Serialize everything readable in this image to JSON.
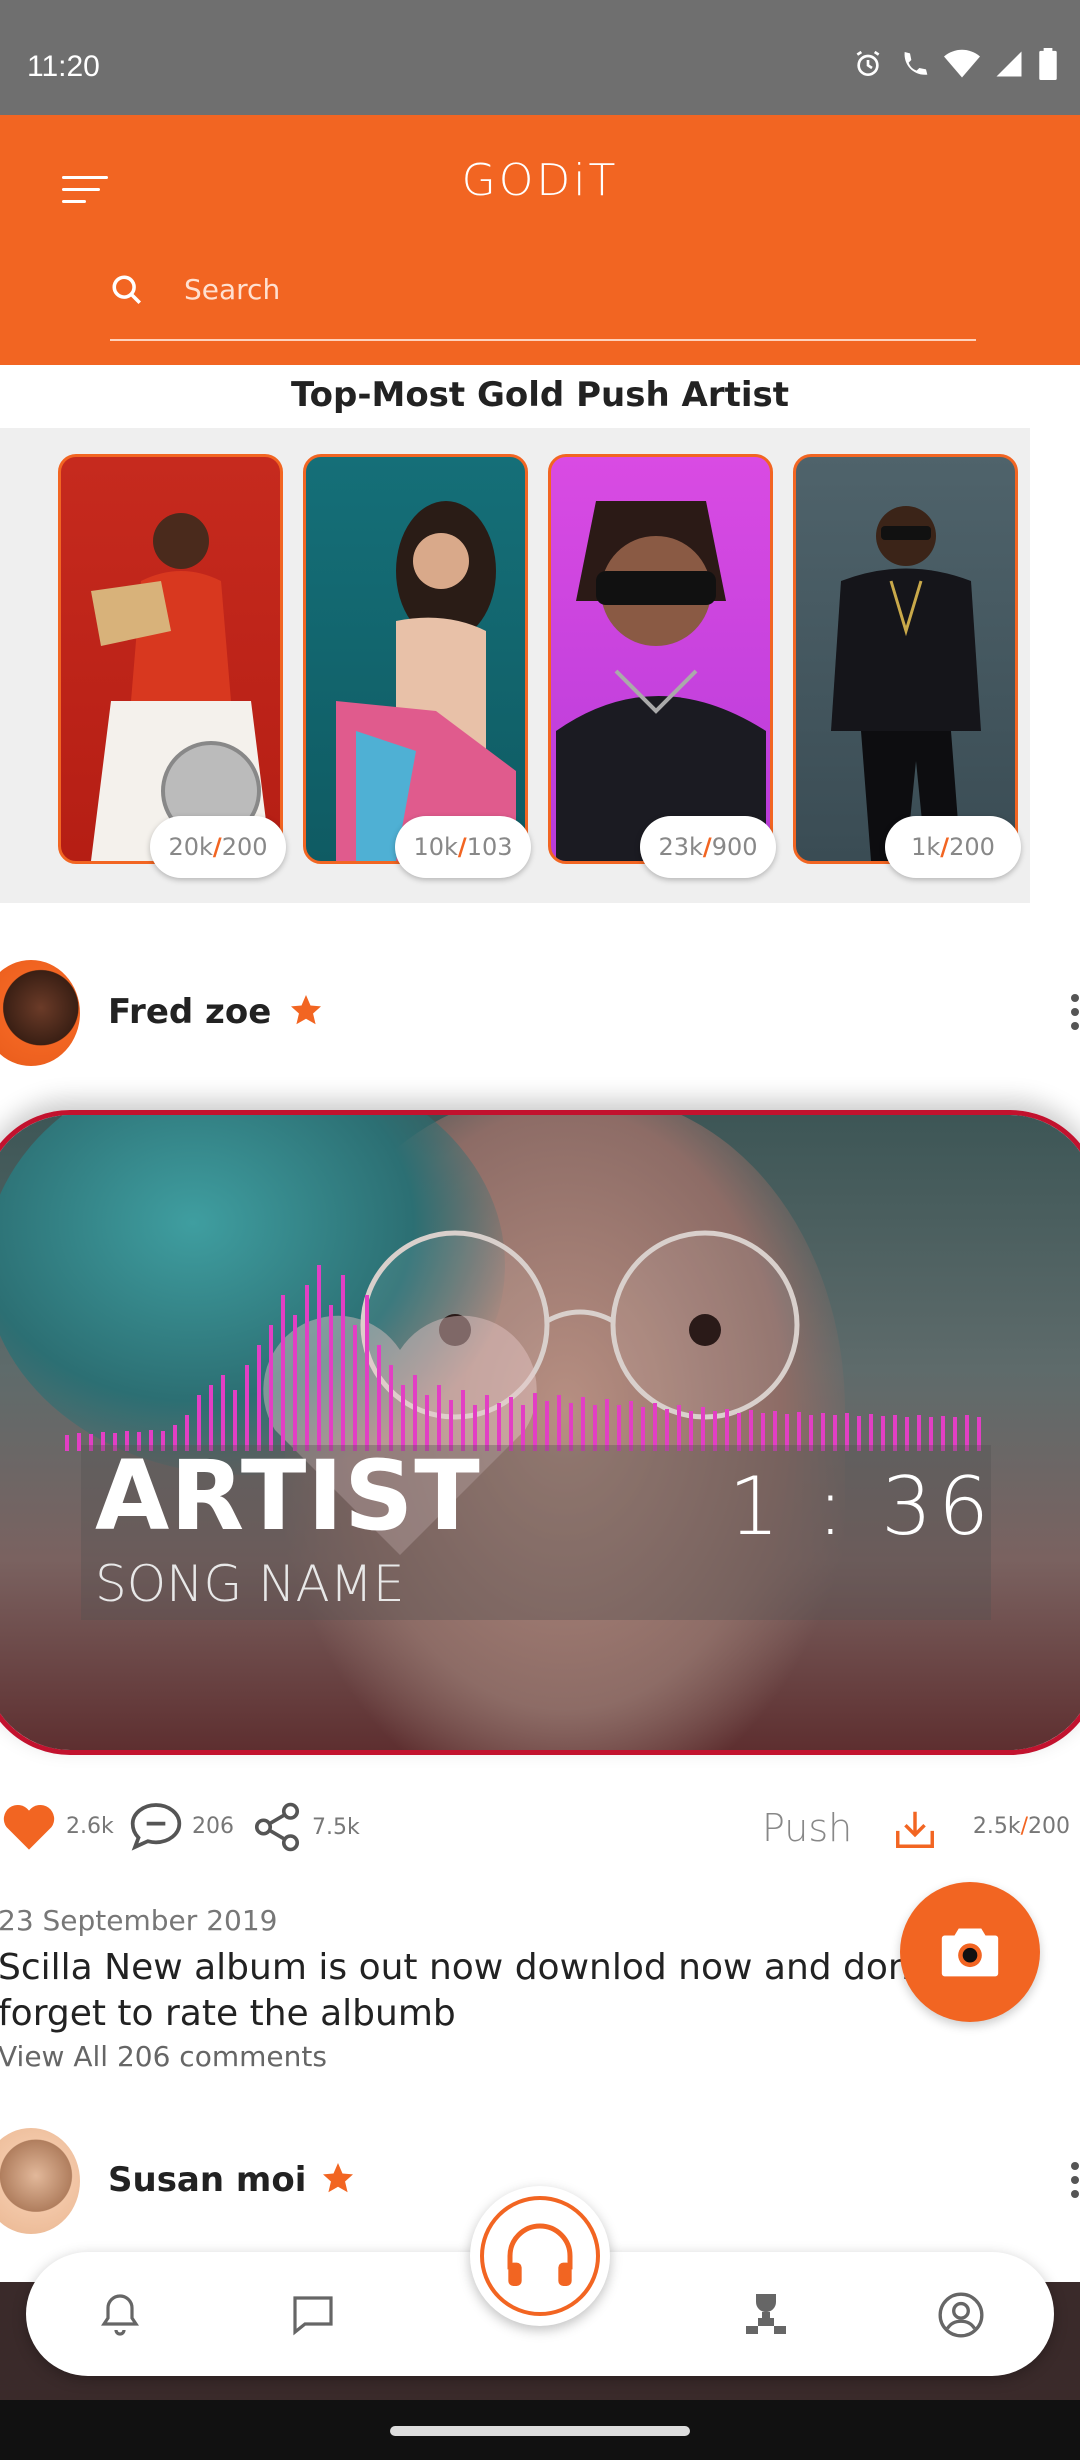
{
  "status_bar": {
    "time": "11:20",
    "icons": [
      "alarm-icon",
      "wifi-call-icon",
      "wifi-icon",
      "signal-icon",
      "battery-icon"
    ]
  },
  "header": {
    "title": "GODiT",
    "search_placeholder": "Search",
    "accent_color": "#f26522"
  },
  "top_artists": {
    "title": "Top-Most Gold Push Artist",
    "cards": [
      {
        "count": "20k",
        "total": "200"
      },
      {
        "count": "10k",
        "total": "103"
      },
      {
        "count": "23k",
        "total": "900"
      },
      {
        "count": "1k",
        "total": "200"
      }
    ]
  },
  "posts": [
    {
      "author": "Fred zoe",
      "media": {
        "artist": "ARTIST",
        "song": "SONG NAME",
        "time": "1 : 36"
      },
      "likes": "2.6k",
      "comments": "206",
      "shares": "7.5k",
      "push_label": "Push",
      "push_count": "2.5k",
      "push_total": "200",
      "date": "23 September 2019",
      "caption": "Scilla New album is out now downlod now and don't forget to rate the albumb",
      "view_comments": "View All 206 comments"
    },
    {
      "author": "Susan moi"
    }
  ],
  "bottom_nav": {
    "items": [
      "bell-icon",
      "chat-icon",
      "headphones-icon",
      "leaderboard-icon",
      "profile-icon"
    ]
  }
}
